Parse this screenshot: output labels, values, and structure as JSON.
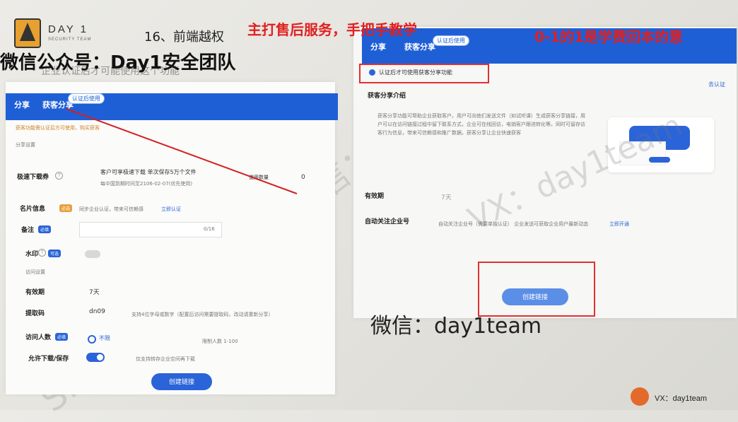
{
  "logo": {
    "name": "DAY 1",
    "sub": "SECURITY TEAM"
  },
  "slide": {
    "number": "16、前端越权"
  },
  "top_red": {
    "left": "主打售后服务，手把手教学",
    "right": "0-1的1是学费回本的意"
  },
  "wechat_overlay": "微信公众号：Day1安全团队",
  "overlay_faded": "企业认证后才可能使用这个功能",
  "left_panel": {
    "tabs": {
      "share": "分享",
      "acquire": "获客分享",
      "pill": "认证后使用"
    },
    "warning": "获客功能需认证后方可使用，购买获客",
    "section": "分享设置",
    "rows": {
      "limit_label": "极速下载券",
      "limit_desc": "客户可享极速下载 单次保存5万个文件",
      "limit_sub": "每中国到期时间至2106-02-07(优先使用)",
      "use_count": "使用数量",
      "count_value": "0",
      "card_label": "名片信息",
      "card_badge": "必选",
      "card_hint": "同步企业认证，带来可信赖感",
      "card_link": "立即认证",
      "remark_label": "备注",
      "remark_badge": "必填",
      "remark_count": "0/16",
      "wm_label": "水印",
      "wm_badge": "可选",
      "access_section": "访问设置",
      "valid_label": "有效期",
      "valid_value": "7天",
      "pwd_label": "提取码",
      "pwd_value": "dn09",
      "pwd_hint": "支持4位字母或数字（配置后访问需要提取码，改动请重新分享）",
      "visitors_label": "访问人数",
      "visitors_badge": "必填",
      "visitors_radio": "不限",
      "visitors_hint": "限制人数 1-100",
      "allow_label": "允许下载/保存",
      "allow_hint": "仅支持转存企业空间再下载"
    },
    "create_button": "创建链接"
  },
  "right_panel": {
    "tabs": {
      "share": "分享",
      "acquire": "获客分享",
      "pill": "认证后使用"
    },
    "notice": "认证后才可使用获客分享功能",
    "go_verify": "去认证",
    "intro_title": "获客分享介绍",
    "intro_text": "获客分享功能可帮助企业获取客户。用户可向他们发送文件（如试听课）生成获客分享链接，用户可以在访问链接过程中留下联系方式，企业可在线回访，电销客户跟进转化等。同时可留存访客行为信息，带来可信赖感和推广数据。获客分享让企业快速获客",
    "valid_label": "有效期",
    "valid_value": "7天",
    "follow_label": "自动关注企业号",
    "follow_hint": "自动关注企业号（需要单独认证）  企业发送可获取企业用户最新动态",
    "follow_link": "立即开通",
    "create_button": "创建链接"
  },
  "wechat_bottom": "微信：day1team",
  "watermark_main": "SRC&众测挖洞培训微信：day1team",
  "vx": "VX：day1team"
}
